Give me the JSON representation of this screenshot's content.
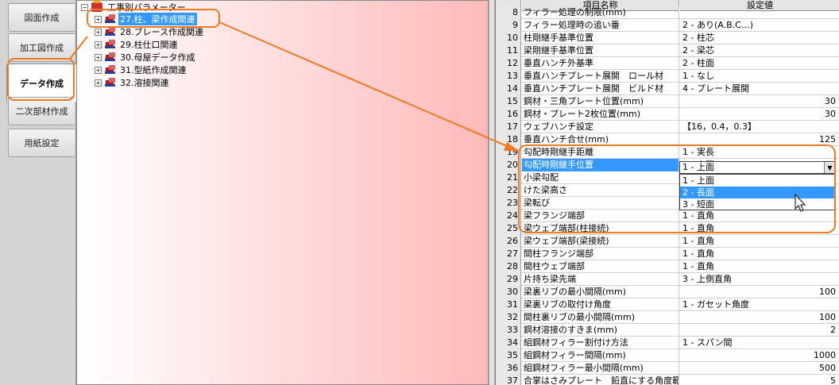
{
  "sidetabs": [
    {
      "label": "図面作成"
    },
    {
      "label": "加工図作成"
    },
    {
      "label": "データ作成"
    },
    {
      "label": "二次部材作成"
    },
    {
      "label": "用紙設定"
    }
  ],
  "tree": {
    "root": "工事別パラメーター",
    "expander_symbol": "+",
    "collapse_symbol": "−",
    "items": [
      {
        "label": "27.柱、梁作成関連"
      },
      {
        "label": "28.ブレース作成関連"
      },
      {
        "label": "29.柱仕口関連"
      },
      {
        "label": "30.母屋データ作成"
      },
      {
        "label": "31.型紙作成関連"
      },
      {
        "label": "32.溶接関連"
      }
    ]
  },
  "grid": {
    "headers": {
      "name": "項目名称",
      "value": "設定値"
    },
    "rows": [
      {
        "no": "8",
        "name": "フィラー処理の制限(mm)",
        "value": ""
      },
      {
        "no": "9",
        "name": "フィラー処理時の追い番",
        "value": "2 - あり(A.B.C…)"
      },
      {
        "no": "10",
        "name": "柱剛継手基準位置",
        "value": "2 - 柱芯"
      },
      {
        "no": "11",
        "name": "梁剛継手基準位置",
        "value": "2 - 梁芯"
      },
      {
        "no": "12",
        "name": "垂直ハンチ外基準",
        "value": "2 - 柱面"
      },
      {
        "no": "13",
        "name": "垂直ハンチプレート展開　ロール材",
        "value": "1 - なし"
      },
      {
        "no": "14",
        "name": "垂直ハンチプレート展開　ビルド材",
        "value": "4 - プレート展開"
      },
      {
        "no": "15",
        "name": "鋼材・三角プレート位置(mm)",
        "value": "30"
      },
      {
        "no": "16",
        "name": "鋼材・プレート2枚位置(mm)",
        "value": "30"
      },
      {
        "no": "17",
        "name": "ウェブハンチ設定",
        "value": "【16，0.4，0.3】"
      },
      {
        "no": "18",
        "name": "垂直ハンチ合せ(mm)",
        "value": "125"
      },
      {
        "no": "19",
        "name": "勾配時剛継手距離",
        "value": "1 - 実長"
      },
      {
        "no": "20",
        "name": "勾配時剛継手位置",
        "value": "1 - 上面"
      },
      {
        "no": "21",
        "name": "小梁勾配",
        "value": "1 - 上面"
      },
      {
        "no": "22",
        "name": "けた梁高さ",
        "value": "2 - 長面"
      },
      {
        "no": "23",
        "name": "梁転び",
        "value": "3 - 短面"
      },
      {
        "no": "24",
        "name": "梁フランジ端部",
        "value": "1 - 直角"
      },
      {
        "no": "25",
        "name": "梁ウェブ端部(柱接続)",
        "value": "1 - 直角"
      },
      {
        "no": "26",
        "name": "梁ウェブ端部(梁接続)",
        "value": "1 - 直角"
      },
      {
        "no": "27",
        "name": "間柱フランジ端部",
        "value": "1 - 直角"
      },
      {
        "no": "28",
        "name": "間柱ウェブ端部",
        "value": "1 - 直角"
      },
      {
        "no": "29",
        "name": "片持ち梁先端",
        "value": "3 - 上側直角"
      },
      {
        "no": "30",
        "name": "梁裏リブの最小間隔(mm)",
        "value": "100"
      },
      {
        "no": "31",
        "name": "梁裏リブの取付け角度",
        "value": "1 - ガセット角度"
      },
      {
        "no": "32",
        "name": "間柱裏リブの最小間隔(mm)",
        "value": "100"
      },
      {
        "no": "33",
        "name": "鋼材溶接のすきま(mm)",
        "value": "2"
      },
      {
        "no": "34",
        "name": "組鋼材フィラー割付け方法",
        "value": "1 - スパン間"
      },
      {
        "no": "35",
        "name": "組鋼材フィラー間隔(mm)",
        "value": "1000"
      },
      {
        "no": "36",
        "name": "組鋼材フィラー最小間隔(mm)",
        "value": "500"
      },
      {
        "no": "37",
        "name": "合掌はさみプレート　鉛直にする角度範囲",
        "value": "5"
      }
    ],
    "combo": {
      "value": "1 - 上面",
      "arrow": "▼",
      "options": [
        "1 - 上面",
        "2 - 長面",
        "3 - 短面"
      ],
      "highlighted_index": 1
    }
  },
  "colors": {
    "accent": "#3399ff",
    "annotation": "#ef7a22",
    "tree_gradient_end": "#ffb9b9"
  }
}
